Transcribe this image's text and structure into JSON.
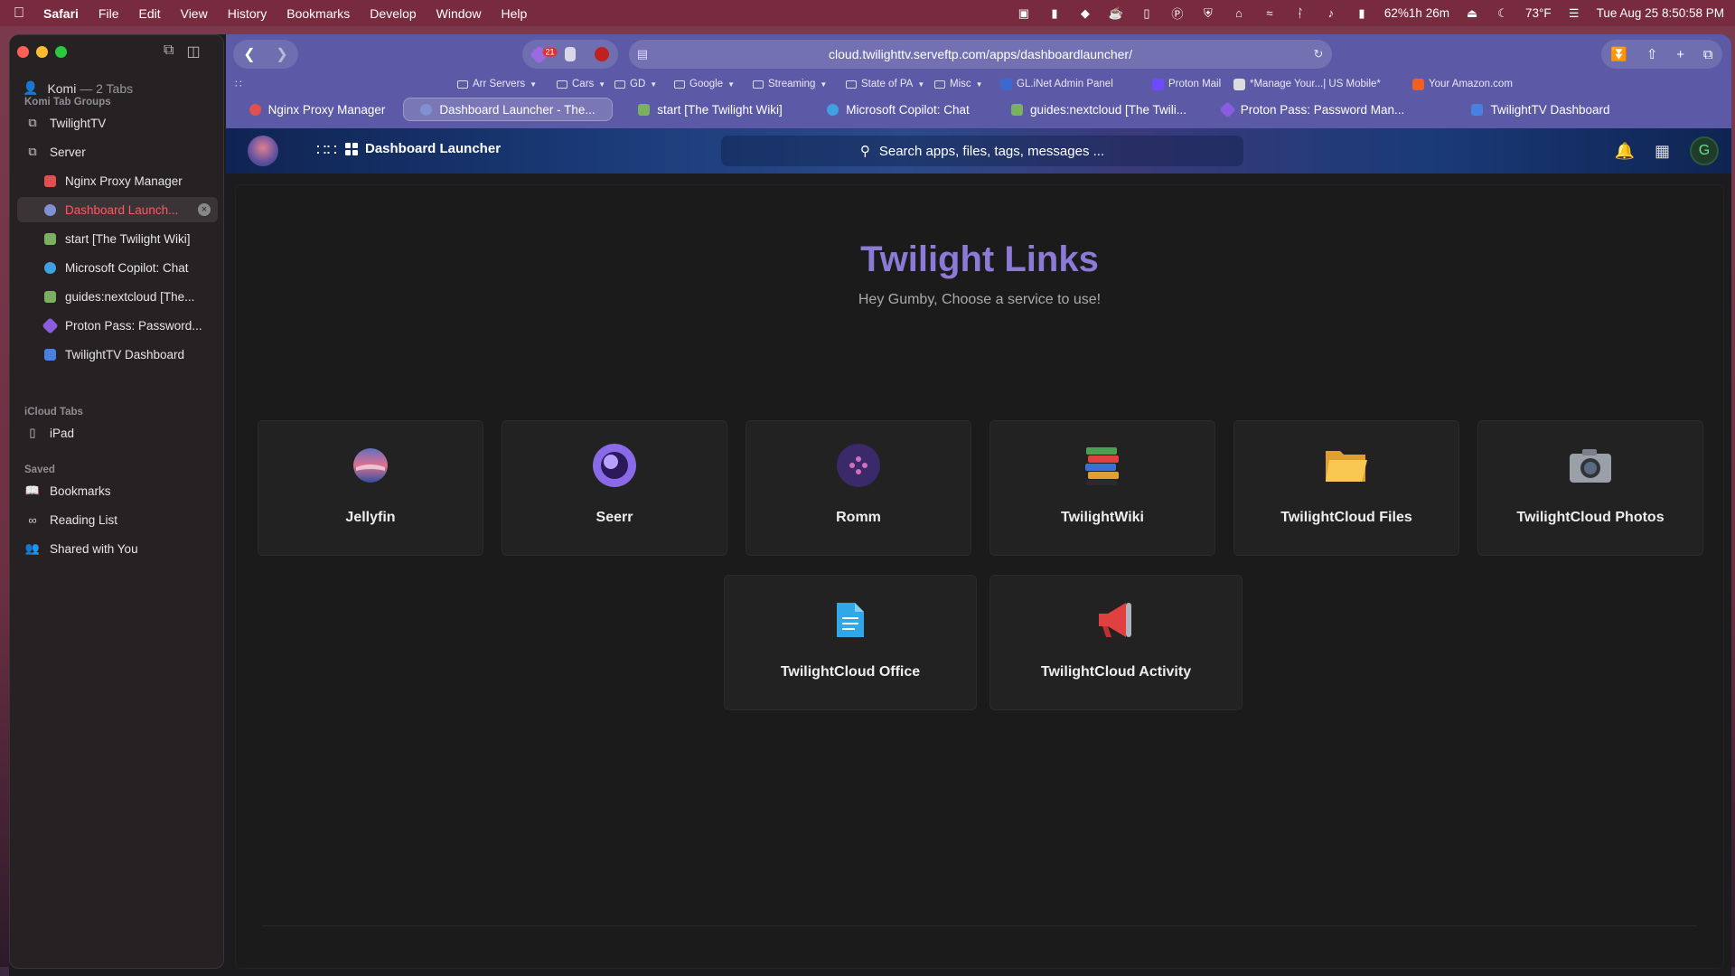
{
  "menubar": {
    "app": "Safari",
    "items": [
      "File",
      "Edit",
      "View",
      "History",
      "Bookmarks",
      "Develop",
      "Window",
      "Help"
    ],
    "battery": "62%1h 26m",
    "weather": "73°F",
    "datetime": "Tue Aug 25  8:50:58 PM"
  },
  "sidebar": {
    "profile_name": "Komi",
    "profile_tabs": " — 2 Tabs",
    "tab_groups_header": "Komi Tab Groups",
    "groups": [
      {
        "label": "TwilightTV"
      },
      {
        "label": "Server"
      }
    ],
    "server_tabs": [
      {
        "label": "Nginx Proxy Manager",
        "color": "#e05050"
      },
      {
        "label": "Dashboard Launch...",
        "color": "#8090d0"
      },
      {
        "label": "start [The Twilight Wiki]",
        "color": "#7ab060"
      },
      {
        "label": "Microsoft Copilot: Chat",
        "color": "#40a0e0"
      },
      {
        "label": "guides:nextcloud [The...",
        "color": "#7ab060"
      },
      {
        "label": "Proton Pass: Password...",
        "color": "#8a5ce0"
      },
      {
        "label": "TwilightTV Dashboard",
        "color": "#4a80e0"
      }
    ],
    "icloud_header": "iCloud Tabs",
    "icloud_device": "iPad",
    "saved_header": "Saved",
    "saved": [
      {
        "label": "Bookmarks"
      },
      {
        "label": "Reading List"
      },
      {
        "label": "Shared with You"
      }
    ]
  },
  "toolbar": {
    "extension_badge": "21",
    "url": "cloud.twilighttv.serveftp.com/apps/dashboardlauncher/"
  },
  "bookmarks": [
    {
      "label": "Arr Servers",
      "folder": true
    },
    {
      "label": "Cars",
      "folder": true
    },
    {
      "label": "GD",
      "folder": true
    },
    {
      "label": "Google",
      "folder": true
    },
    {
      "label": "Streaming",
      "folder": true
    },
    {
      "label": "State of PA",
      "folder": true
    },
    {
      "label": "Misc",
      "folder": true
    },
    {
      "label": "GL.iNet Admin Panel",
      "folder": false
    },
    {
      "label": "Proton Mail",
      "folder": false
    },
    {
      "label": "*Manage Your...| US Mobile*",
      "folder": false
    },
    {
      "label": "Your Amazon.com",
      "folder": false
    }
  ],
  "tabs": [
    {
      "label": "Nginx Proxy Manager",
      "color": "#e05050"
    },
    {
      "label": "Dashboard Launcher - The...",
      "color": "#8090d0"
    },
    {
      "label": "start [The Twilight Wiki]",
      "color": "#7ab060"
    },
    {
      "label": "Microsoft Copilot: Chat",
      "color": "#40a0e0"
    },
    {
      "label": "guides:nextcloud [The Twili...",
      "color": "#7ab060"
    },
    {
      "label": "Proton Pass: Password Man...",
      "color": "#8a5ce0"
    },
    {
      "label": "TwilightTV Dashboard",
      "color": "#4a80e0"
    }
  ],
  "header": {
    "app_name": "Dashboard Launcher",
    "search_placeholder": "Search apps, files, tags, messages ...",
    "avatar_letter": "G"
  },
  "main": {
    "title": "Twilight Links",
    "subtitle": "Hey Gumby, Choose a service to use!",
    "cards": [
      {
        "label": "Jellyfin",
        "icon": "jellyfin-icon"
      },
      {
        "label": "Seerr",
        "icon": "seerr-icon"
      },
      {
        "label": "Romm",
        "icon": "romm-icon"
      },
      {
        "label": "TwilightWiki",
        "icon": "books-icon"
      },
      {
        "label": "TwilightCloud Files",
        "icon": "folder-icon"
      },
      {
        "label": "TwilightCloud Photos",
        "icon": "camera-icon"
      },
      {
        "label": "TwilightCloud Office",
        "icon": "document-icon"
      },
      {
        "label": "TwilightCloud Activity",
        "icon": "megaphone-icon"
      }
    ]
  }
}
